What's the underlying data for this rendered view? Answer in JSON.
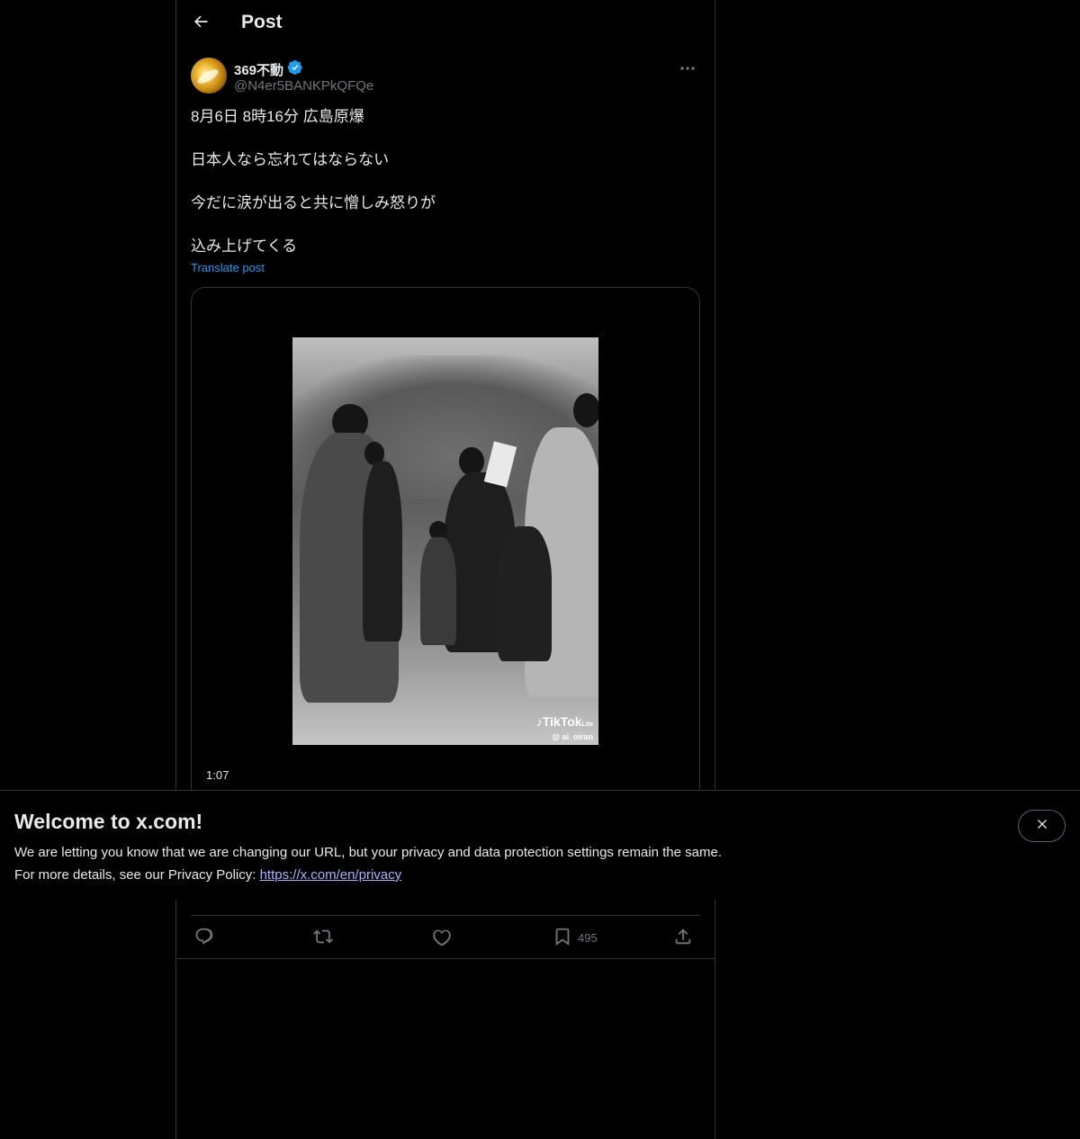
{
  "header": {
    "title": "Post"
  },
  "author": {
    "display_name": "369不動",
    "handle": "@N4er5BANKPkQFQe",
    "verified": true
  },
  "post": {
    "lines": [
      "8月6日 8時16分 広島原爆",
      "日本人なら忘れてはならない",
      "今だに涙が出ると共に憎しみ怒りが",
      "込み上げてくる"
    ],
    "translate_label": "Translate post"
  },
  "media": {
    "duration": "1:07",
    "watermark_brand": "TikTok",
    "watermark_suffix": "Lite",
    "watermark_user": "@ ai_oiran"
  },
  "actions": {
    "bookmark_count": "495"
  },
  "banner": {
    "title": "Welcome to x.com!",
    "text_line1": "We are letting you know that we are changing our URL, but your privacy and data protection settings remain the same.",
    "text_line2_prefix": "For more details, see our Privacy Policy: ",
    "link_text": "https://x.com/en/privacy"
  },
  "colors": {
    "background": "#000000",
    "text_primary": "#e7e9ea",
    "text_secondary": "#71767b",
    "accent": "#1d9bf0",
    "border": "#2f3336",
    "link_banner": "#a8b3ff"
  },
  "icons": {
    "back": "arrow-left-icon",
    "verified": "verified-badge-icon",
    "more": "more-horizontal-icon",
    "reply": "reply-icon",
    "repost": "repost-icon",
    "like": "like-icon",
    "bookmark": "bookmark-icon",
    "share": "share-icon",
    "close": "close-icon"
  }
}
